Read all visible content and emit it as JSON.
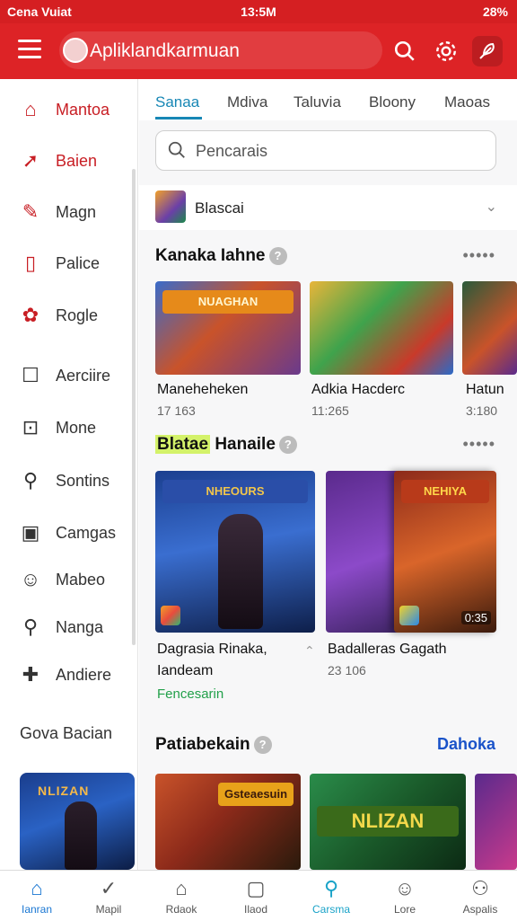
{
  "status": {
    "left": "Cena Vuiat",
    "time": "13:5M",
    "right": "28%"
  },
  "header": {
    "app_name": "Apliklandkarmuan"
  },
  "sidebar": {
    "items": [
      {
        "label": "Mantoa",
        "icon": "home-icon"
      },
      {
        "label": "Baien",
        "icon": "arrow-icon"
      },
      {
        "label": "Magn",
        "icon": "note-icon"
      },
      {
        "label": "Palice",
        "icon": "clipboard-icon"
      },
      {
        "label": "Rogle",
        "icon": "puzzle-icon"
      },
      {
        "label": "Aerciire",
        "icon": "square-icon"
      },
      {
        "label": "Mone",
        "icon": "box-icon"
      },
      {
        "label": "Sontins",
        "icon": "tag-icon"
      },
      {
        "label": "Camgas",
        "icon": "frame-icon"
      },
      {
        "label": "Mabeo",
        "icon": "people-icon"
      },
      {
        "label": "Nanga",
        "icon": "search-icon"
      },
      {
        "label": "Andiere",
        "icon": "puzzle-piece-icon"
      }
    ],
    "section_label": "Gova Bacian",
    "thumb_text": "NLIZAN"
  },
  "tabs": [
    "Sanaa",
    "Mdiva",
    "Taluvia",
    "Bloony",
    "Maoas"
  ],
  "search": {
    "placeholder": "Pencarais"
  },
  "filter": {
    "label": "Blascai"
  },
  "section1": {
    "title": "Kanaka Iahne",
    "cards": [
      {
        "title": "Maneheheken",
        "sub": "17 163",
        "banner": "NUAGHAN"
      },
      {
        "title": "Adkia Hacderc",
        "sub": "11:265",
        "banner": ""
      },
      {
        "title": "Hatun",
        "sub": "3:180",
        "banner": ""
      }
    ]
  },
  "section2": {
    "highlight": "Blatae",
    "title": "Hanaile",
    "cards": [
      {
        "title_line1": "Dagrasia Rinaka,",
        "title_line2": "Iandeam",
        "sub": "Fencesarin",
        "banner": "NHEOURS"
      },
      {
        "title_line1": "Badalleras Gagath",
        "title_line2": "",
        "sub": "23 106",
        "banner": "NEHIYA",
        "badge": "0:35"
      }
    ]
  },
  "section3": {
    "title": "Patiabekain",
    "see_all": "Dahoka",
    "cards": [
      {
        "banner": "Gsteaesuin"
      },
      {
        "banner": "NLIZAN"
      }
    ]
  },
  "bottom_nav": [
    {
      "label": "Ianran",
      "icon": "home-icon",
      "state": "active"
    },
    {
      "label": "Mapil",
      "icon": "check-badge-icon",
      "state": ""
    },
    {
      "label": "Rdaok",
      "icon": "house-outline-icon",
      "state": ""
    },
    {
      "label": "Ilaod",
      "icon": "package-icon",
      "state": ""
    },
    {
      "label": "Carsma",
      "icon": "location-icon",
      "state": "cyan"
    },
    {
      "label": "Lore",
      "icon": "user-icon",
      "state": ""
    },
    {
      "label": "Aspalis",
      "icon": "chat-user-icon",
      "state": ""
    }
  ]
}
